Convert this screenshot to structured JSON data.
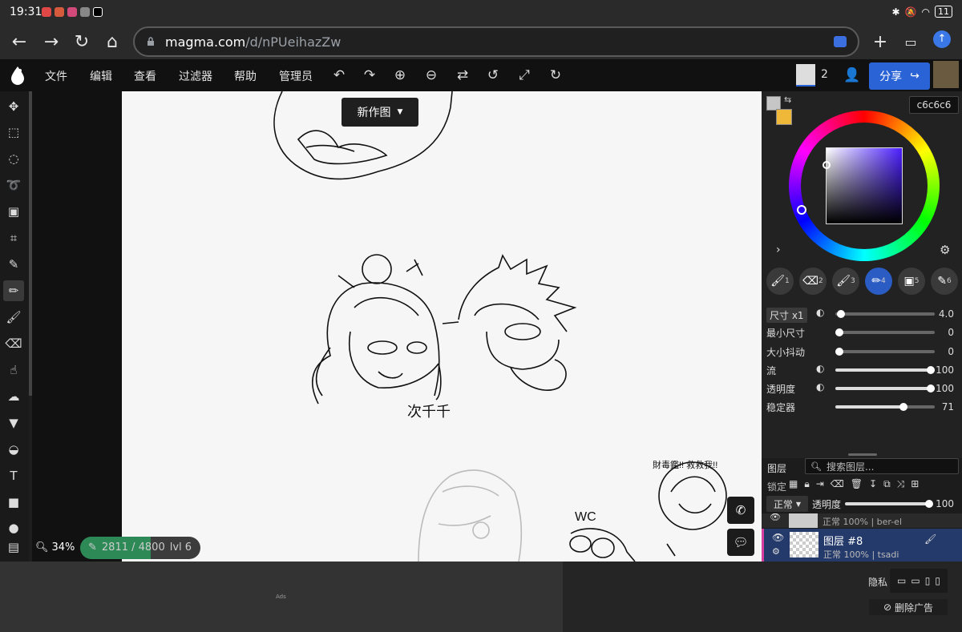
{
  "status": {
    "time": "19:31",
    "battery": "11"
  },
  "browser": {
    "url_host": "magma.com",
    "url_path": "/d/nPUeihazZw"
  },
  "menu": {
    "file": "文件",
    "edit": "编辑",
    "view": "查看",
    "filter": "过滤器",
    "help": "帮助",
    "admin": "管理员"
  },
  "collab": {
    "count": "2"
  },
  "share_label": "分享",
  "canvas": {
    "new_doc_label": "新作图",
    "zoom": "34%",
    "progress_text": "2811 / 4800",
    "level": "lvl 6",
    "progress_fraction": 0.586,
    "drawing_text": "次千千",
    "wc_text": "WC",
    "small_text": "財毒鑑!! 救救我!!"
  },
  "color": {
    "hex": "c6c6c6",
    "primary": "#c6c6c6",
    "secondary": "#f0b838"
  },
  "brushes": {
    "slots": [
      "1",
      "2",
      "3",
      "4",
      "5",
      "6"
    ]
  },
  "sliders": {
    "size_label": "尺寸 x1",
    "size_value": "4.0",
    "min_size_label": "最小尺寸",
    "min_size_value": "0",
    "jitter_label": "大小抖动",
    "jitter_value": "0",
    "flow_label": "流",
    "flow_value": "100",
    "opacity_label": "透明度",
    "opacity_value": "100",
    "stabilizer_label": "稳定器",
    "stabilizer_value": "71"
  },
  "layers": {
    "title": "图层",
    "search_placeholder": "搜索图层...",
    "lock_label": "锁定",
    "blend_mode": "正常",
    "opacity_label": "透明度",
    "opacity_value": "100",
    "rows": [
      {
        "name": "",
        "meta": "正常 100% | ber-el"
      },
      {
        "name": "图层 #8",
        "meta": "正常 100% | tsadi"
      }
    ]
  },
  "footer": {
    "ads_label": "Ads",
    "privacy_label": "隐私",
    "remove_ads_label": "删除广告"
  }
}
